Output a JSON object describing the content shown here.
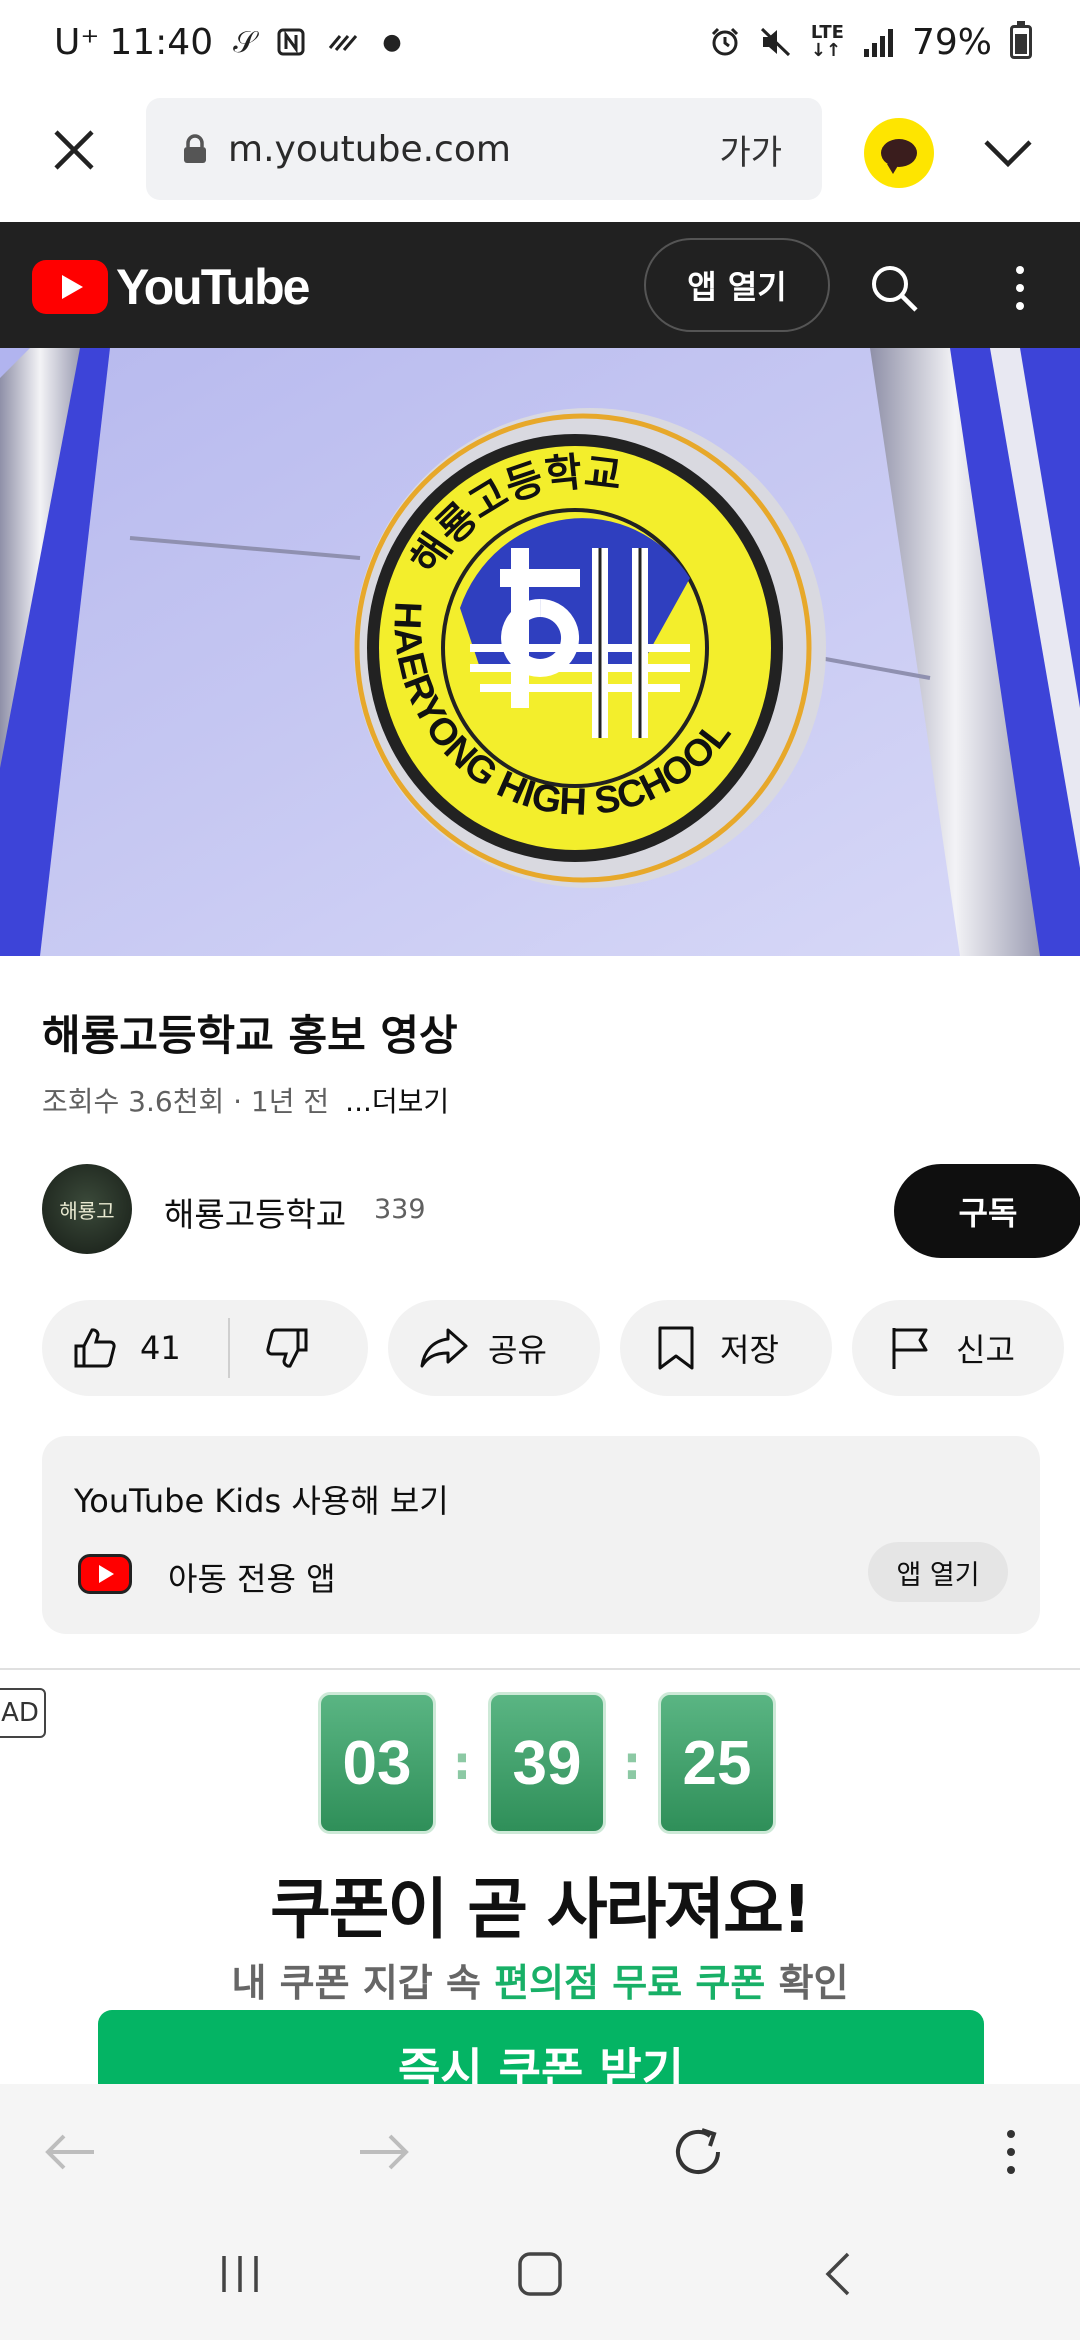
{
  "status_bar": {
    "carrier": "U⁺",
    "time": "11:40",
    "battery": "79%"
  },
  "browser": {
    "url": "m.youtube.com",
    "text_size_label": "가가"
  },
  "youtube_header": {
    "logo_text": "YouTube",
    "open_app_label": "앱 열기"
  },
  "video": {
    "emblem_korean": "해룡고등학교",
    "emblem_english": "HAERYONG HIGH SCHOOL"
  },
  "meta": {
    "title": "해룡고등학교 홍보 영상",
    "views": "조회수 3.6천회 · 1년 전",
    "more_label": "...더보기"
  },
  "channel": {
    "name": "해룡고등학교",
    "subscribers": "339",
    "avatar_text": "해룡고",
    "subscribe_label": "구독"
  },
  "actions": {
    "like_count": "41",
    "share_label": "공유",
    "save_label": "저장",
    "report_label": "신고"
  },
  "kids_card": {
    "title": "YouTube Kids 사용해 보기",
    "subtitle": "아동 전용 앱",
    "open_label": "앱 열기"
  },
  "ad": {
    "badge": "AD",
    "timer": [
      "03",
      "39",
      "25"
    ],
    "headline": "쿠폰이 곧 사라져요!",
    "sub_prefix": "내 쿠폰 지갑 속 ",
    "sub_highlight": "편의점 무료 쿠폰",
    "sub_suffix": " 확인",
    "cta_label": "즉시 쿠폰 받기"
  },
  "colors": {
    "youtube_red": "#ff0000",
    "header_bg": "#212121",
    "kakao_yellow": "#fee500",
    "ad_green": "#04b464"
  }
}
